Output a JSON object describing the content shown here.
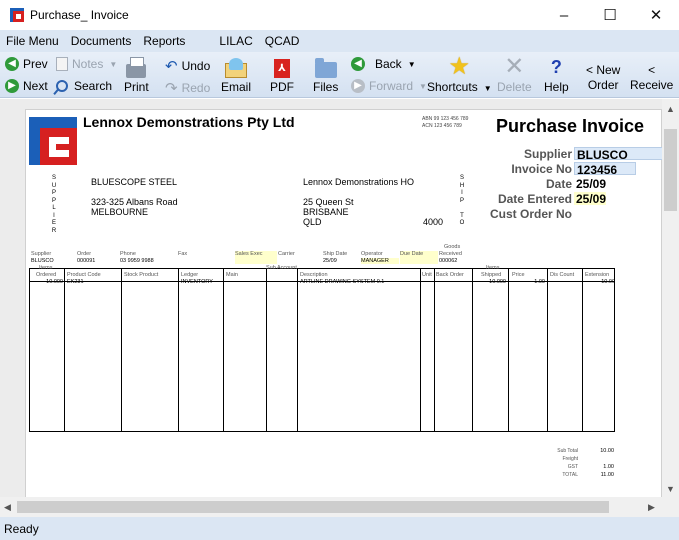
{
  "window": {
    "title": "Purchase_ Invoice",
    "minimize": "–",
    "maximize": "☐",
    "close": "✕"
  },
  "menu": [
    "File Menu",
    "Documents",
    "Reports",
    "LILAC",
    "QCAD"
  ],
  "toolbar": {
    "prev": "Prev",
    "next": "Next",
    "notes": "Notes",
    "search": "Search",
    "print": "Print",
    "undo": "Undo",
    "redo": "Redo",
    "email": "Email",
    "pdf": "PDF",
    "files": "Files",
    "back": "Back",
    "forward": "Forward",
    "shortcuts": "Shortcuts",
    "delete": "Delete",
    "help": "Help",
    "new_order_1": "< New",
    "new_order_2": "Order",
    "receive_1": "<",
    "receive_2": "Receive"
  },
  "invoice": {
    "company": "Lennox Demonstrations Pty Ltd",
    "abn": "ABN 99 123 456 789",
    "acn": "ACN 123 456 789",
    "title": "Purchase Invoice",
    "fields": [
      {
        "label": "Supplier",
        "value": "BLUSCO",
        "highlight": "blue"
      },
      {
        "label": "Invoice No",
        "value": "123456",
        "highlight": "blue"
      },
      {
        "label": "Date",
        "value": "25/09",
        "highlight": "none"
      },
      {
        "label": "Date Entered",
        "value": "25/09",
        "highlight": "yellow"
      },
      {
        "label": "Cust Order No",
        "value": "",
        "highlight": "none"
      }
    ],
    "supplier_vertical": [
      "S",
      "U",
      "P",
      "P",
      "L",
      "I",
      "E",
      "R"
    ],
    "ship_vertical": [
      "S",
      "H",
      "I",
      "P",
      "",
      "T",
      "O"
    ],
    "supplier_address": [
      "BLUESCOPE STEEL",
      "",
      "323-325 Albans Road",
      "MELBOURNE"
    ],
    "ship_address": [
      "Lennox Demonstrations HO",
      "",
      "25 Queen St",
      "BRISBANE",
      "QLD"
    ],
    "ship_postcode": "4000",
    "header_labels": {
      "supplier": "Supplier",
      "order": "Order",
      "phone": "Phone",
      "fax": "Fax",
      "sales_exec": "Sales Exec",
      "carrier": "Carrier",
      "ship_date": "Ship Date",
      "operator": "Operator",
      "due_date": "Due Date",
      "goods_received_1": "Goods",
      "goods_received_2": "Received"
    },
    "header_values": {
      "supplier": "BLUSCO",
      "order": "000091",
      "phone": "03 9959 9988",
      "fax": "",
      "sales_exec": "",
      "carrier": "",
      "ship_date": "25/09",
      "operator": "MANAGER",
      "due_date": "",
      "goods_received": "000062"
    },
    "columns": {
      "items_ordered_1": "Items",
      "items_ordered_2": "Ordered",
      "product_code": "Product Code",
      "stock_product": "Stock Product",
      "ledger": "Ledger",
      "main": "Main",
      "sub_account": "Sub Account",
      "description": "Description",
      "unit": "Unit",
      "back_order": "Back Order",
      "items_shipped_1": "Items",
      "items_shipped_2": "Shipped",
      "price": "Price",
      "dis_count": "Dis Count",
      "extension": "Extension"
    },
    "line": {
      "items_ordered": "10.000",
      "product_code": "EK231",
      "ledger": "INVENTORY",
      "description": "ARTLINE DRAWING SYSTEM 0.1",
      "items_shipped": "10.000",
      "price": "1.00",
      "extension": "10.00"
    },
    "totals": [
      {
        "label": "Sub Total",
        "value": "10.00"
      },
      {
        "label": "Freight",
        "value": ""
      },
      {
        "label": "GST",
        "value": "1.00"
      },
      {
        "label": "TOTAL",
        "value": "11.00"
      }
    ]
  },
  "status": "Ready"
}
